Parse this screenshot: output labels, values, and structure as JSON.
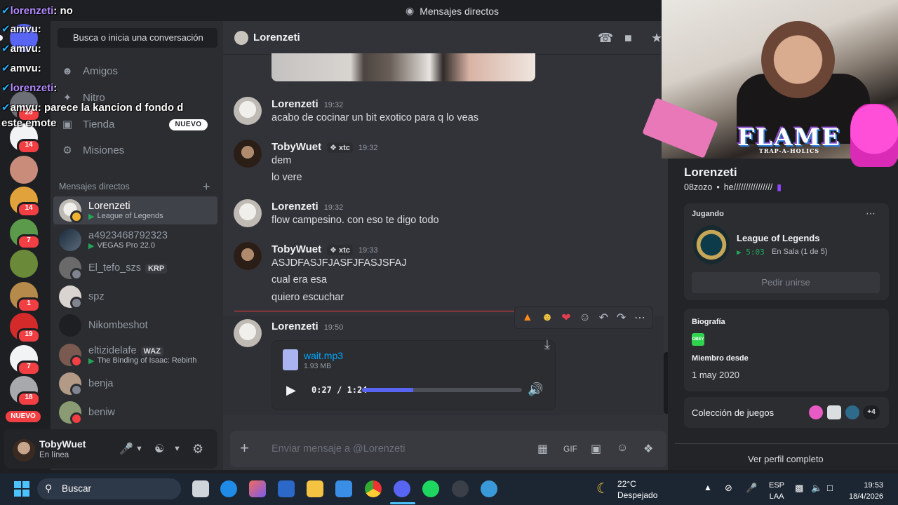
{
  "topbar": {
    "title": "Mensajes directos"
  },
  "servers": [
    {
      "badge": "26"
    },
    {
      "badge": "14"
    },
    {
      "badge": ""
    },
    {
      "badge": "14"
    },
    {
      "badge": "7"
    },
    {
      "badge": ""
    },
    {
      "badge": "1"
    },
    {
      "badge": "19"
    },
    {
      "badge": "7"
    },
    {
      "badge": "18"
    }
  ],
  "rail_new_label": "NUEVO",
  "sidebar": {
    "search_placeholder": "Busca o inicia una conversación",
    "nav": {
      "friends": "Amigos",
      "nitro": "Nitro",
      "shop": "Tienda",
      "shop_tag": "NUEVO",
      "quests": "Misiones"
    },
    "dm_header": "Mensajes directos",
    "dms": [
      {
        "name": "Lorenzeti",
        "sub": "League of Legends"
      },
      {
        "name": "a4923468792323",
        "sub": "VEGAS Pro 22.0"
      },
      {
        "name": "El_tefo_szs",
        "tag": "KRP"
      },
      {
        "name": "spz"
      },
      {
        "name": "Nikombeshot"
      },
      {
        "name": "eltizidelafe",
        "tag": "WAZ",
        "sub": "The Binding of Isaac: Rebirth"
      },
      {
        "name": "benja"
      },
      {
        "name": "beniw"
      }
    ]
  },
  "user_panel": {
    "name": "TobyWuet",
    "status": "En línea"
  },
  "chat": {
    "title": "Lorenzeti",
    "messages": [
      {
        "author": "Lorenzeti",
        "time": "19:32",
        "lines": [
          "acabo de cocinar un bit exotico para q lo veas"
        ]
      },
      {
        "author": "TobyWuet",
        "tag": "xtc",
        "time": "19:32",
        "lines": [
          "dem",
          "lo vere"
        ]
      },
      {
        "author": "Lorenzeti",
        "time": "19:32",
        "lines": [
          "flow campesino. con eso te digo todo"
        ]
      },
      {
        "author": "TobyWuet",
        "tag": "xtc",
        "time": "19:33",
        "lines": [
          "ASJDFASJFJASFJFASJSFAJ",
          "cual era esa",
          "quiero escuchar"
        ]
      },
      {
        "author": "Lorenzeti",
        "time": "19:50"
      }
    ],
    "attachment": {
      "file_name": "wait.mp3",
      "file_size": "1.93 MB",
      "time": "0:27 / 1:24",
      "progress": 0.32
    },
    "composer_placeholder": "Enviar mensaje a @Lorenzeti"
  },
  "profile": {
    "name": "Lorenzeti",
    "handle": "08zozo",
    "custom_status": "he////////////////",
    "playing_label": "Jugando",
    "game": {
      "name": "League of Legends",
      "elapsed": "5:03",
      "party": "En Sala (1 de 5)"
    },
    "join_button": "Pedir unirse",
    "bio_label": "Biografía",
    "bio_emote": "OBEY",
    "member_since_label": "Miembro desde",
    "member_since": "1 may 2020",
    "games_label": "Colección de juegos",
    "games_more": "+4",
    "view_full": "Ver perfil completo"
  },
  "stream_overlay": [
    {
      "user": "lorenzeti",
      "text": "no"
    },
    {
      "user": "amvu",
      "text": ""
    },
    {
      "user": "amvu",
      "text": ""
    },
    {
      "user": "amvu",
      "text": ""
    },
    {
      "user": "lorenzeti",
      "text": ""
    },
    {
      "user": "amvu",
      "text": "parece la kancion d fondo d"
    },
    {
      "user": "",
      "text": "este emote"
    }
  ],
  "webcam": {
    "overlay_text": "FLAME",
    "overlay_sub": "TRAP-A-HOLICS"
  },
  "taskbar": {
    "search": "Buscar",
    "temp": "22°C",
    "weather": "Despejado",
    "lang1": "ESP",
    "lang2": "LAA",
    "time": "19:53",
    "date": "18/4/2026"
  }
}
